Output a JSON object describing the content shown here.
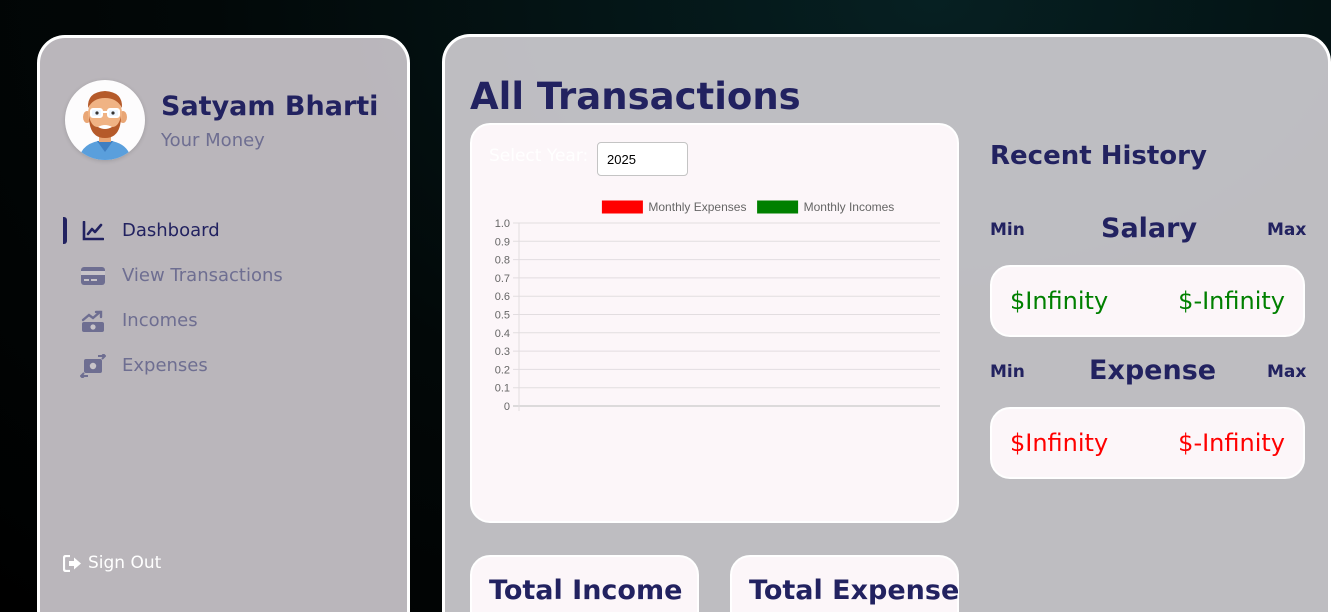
{
  "user": {
    "name": "Satyam Bharti",
    "subtitle": "Your Money",
    "avatar_icon": "avatar-icon"
  },
  "nav": [
    {
      "label": "Dashboard",
      "icon": "chart-line-icon",
      "active": true
    },
    {
      "label": "View Transactions",
      "icon": "credit-card-icon",
      "active": false
    },
    {
      "label": "Incomes",
      "icon": "money-bill-trend-icon",
      "active": false
    },
    {
      "label": "Expenses",
      "icon": "money-bill-transfer-icon",
      "active": false
    }
  ],
  "signout": {
    "label": "Sign Out",
    "icon": "sign-out-icon"
  },
  "main": {
    "title": "All Transactions",
    "year_label": "Select Year:",
    "year_value": "2025"
  },
  "history": {
    "title": "Recent History",
    "min_label": "Min",
    "max_label": "Max",
    "salary": {
      "heading": "Salary",
      "min": "$Infinity",
      "max": "$-Infinity",
      "color": "#008000"
    },
    "expense": {
      "heading": "Expense",
      "min": "$Infinity",
      "max": "$-Infinity",
      "color": "#ff0000"
    }
  },
  "totals": {
    "income_title": "Total Income",
    "expense_title": "Total Expense"
  },
  "chart_data": {
    "type": "bar",
    "categories": [],
    "series": [
      {
        "name": "Monthly Expenses",
        "values": [],
        "color": "#ff0000"
      },
      {
        "name": "Monthly Incomes",
        "values": [],
        "color": "#008000"
      }
    ],
    "yticks": [
      "1.0",
      "0.9",
      "0.8",
      "0.7",
      "0.6",
      "0.5",
      "0.4",
      "0.3",
      "0.2",
      "0.1",
      "0"
    ],
    "ylim": [
      0,
      1
    ],
    "grid": true,
    "legend": "top"
  }
}
